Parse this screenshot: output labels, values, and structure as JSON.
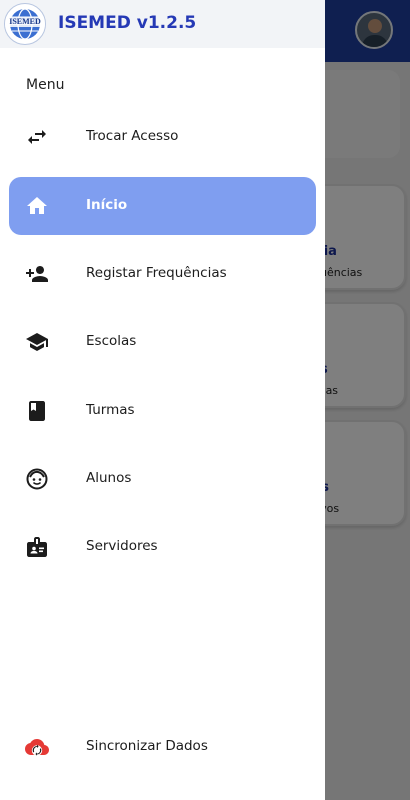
{
  "app": {
    "title": "ISEMED v1.2.5",
    "logo_text": "ISEMED"
  },
  "drawer": {
    "menu_heading": "Menu",
    "items": [
      {
        "label": "Trocar Acesso",
        "icon": "swap-arrows-icon",
        "active": false
      },
      {
        "label": "Início",
        "icon": "home-icon",
        "active": true
      },
      {
        "label": "Registar Frequências",
        "icon": "person-add-icon",
        "active": false
      },
      {
        "label": "Escolas",
        "icon": "graduation-cap-icon",
        "active": false
      },
      {
        "label": "Turmas",
        "icon": "book-icon",
        "active": false
      },
      {
        "label": "Alunos",
        "icon": "child-face-icon",
        "active": false
      },
      {
        "label": "Servidores",
        "icon": "id-badge-icon",
        "active": false
      }
    ],
    "sync": {
      "label": "Sincronizar Dados",
      "icon": "cloud-sync-icon"
    }
  },
  "background": {
    "cards": [
      {
        "title_fragment": "cia",
        "subtitle_fragment": "quências"
      },
      {
        "title_fragment": "s",
        "subtitle_fragment": "lvas"
      },
      {
        "title_fragment": "res",
        "subtitle_fragment": "ativos"
      }
    ]
  },
  "colors": {
    "accent": "#7f9ef0",
    "title_blue": "#2539b5",
    "topbar_blue": "#1e3fa0",
    "sync_red": "#e53935"
  }
}
